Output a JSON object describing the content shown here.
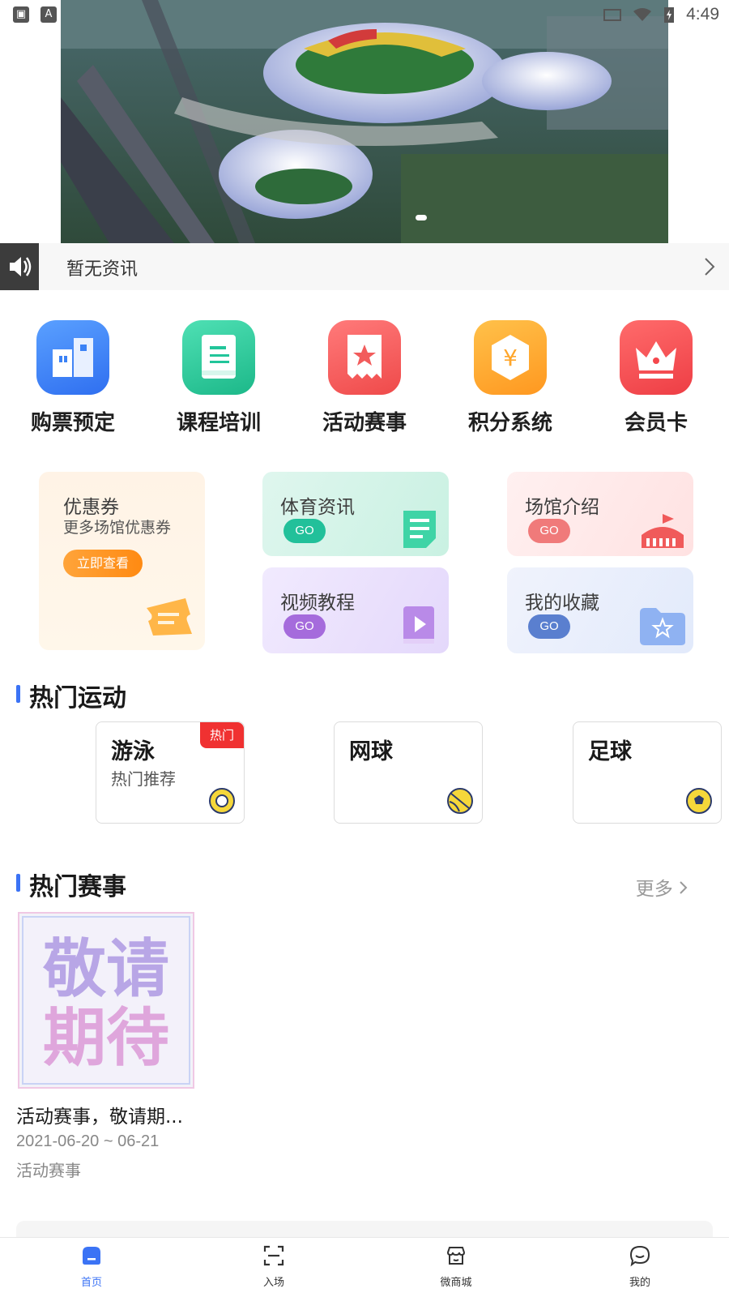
{
  "status_bar": {
    "time": "4:49"
  },
  "notice": {
    "text": "暂无资讯"
  },
  "quick_menu": [
    {
      "label": "购票预定",
      "icon": "building-icon",
      "color": "#3b82f6"
    },
    {
      "label": "课程培训",
      "icon": "book-icon",
      "color": "#22c59a"
    },
    {
      "label": "活动赛事",
      "icon": "star-ticket-icon",
      "color": "#f25c5c"
    },
    {
      "label": "积分系统",
      "icon": "yen-hexagon-icon",
      "color": "#ffa62b"
    },
    {
      "label": "会员卡",
      "icon": "crown-icon",
      "color": "#f5474c"
    }
  ],
  "features": {
    "coupon": {
      "title": "优惠券",
      "subtitle": "更多场馆优惠券",
      "cta": "立即查看"
    },
    "sports_news": {
      "title": "体育资讯",
      "go": "GO"
    },
    "venue_intro": {
      "title": "场馆介绍",
      "go": "GO"
    },
    "video_tutorial": {
      "title": "视频教程",
      "go": "GO"
    },
    "favorites": {
      "title": "我的收藏",
      "go": "GO"
    }
  },
  "hot_sports": {
    "title": "热门运动",
    "items": [
      {
        "name": "游泳",
        "sub": "热门推荐",
        "badge": "热门"
      },
      {
        "name": "网球",
        "sub": "",
        "badge": ""
      },
      {
        "name": "足球",
        "sub": "",
        "badge": ""
      }
    ]
  },
  "hot_events": {
    "title": "热门赛事",
    "more": "更多",
    "poster_text": [
      "敬请",
      "期待"
    ],
    "items": [
      {
        "title": "活动赛事，敬请期...",
        "date": "2021-06-20 ~ 06-21",
        "category": "活动赛事"
      }
    ]
  },
  "tabbar": [
    {
      "label": "首页",
      "icon": "home-icon",
      "active": true
    },
    {
      "label": "入场",
      "icon": "scan-icon",
      "active": false
    },
    {
      "label": "微商城",
      "icon": "shop-icon",
      "active": false
    },
    {
      "label": "我的",
      "icon": "chat-profile-icon",
      "active": false
    }
  ]
}
